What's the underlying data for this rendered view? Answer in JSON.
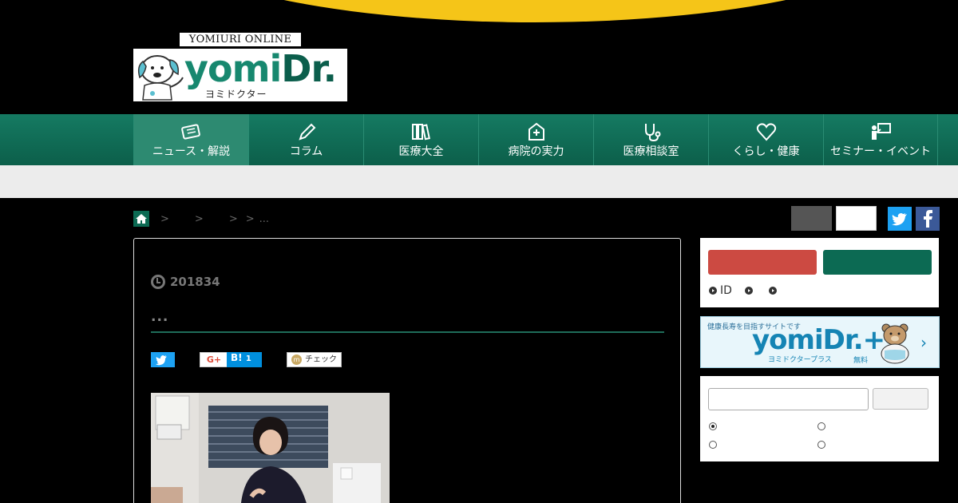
{
  "header": {
    "logo_online": "YOMIURI ONLINE",
    "logo_brand_yomi": "yomi",
    "logo_brand_dr": "Dr.",
    "logo_kana": "ヨミドクター"
  },
  "nav": {
    "items": [
      {
        "label": "ニュース・解説",
        "icon": "newspaper-icon",
        "active": true
      },
      {
        "label": "コラム",
        "icon": "pencil-icon"
      },
      {
        "label": "医療大全",
        "icon": "books-icon"
      },
      {
        "label": "病院の実力",
        "icon": "hospital-icon"
      },
      {
        "label": "医療相談室",
        "icon": "stethoscope-icon"
      },
      {
        "label": "くらし・健康",
        "icon": "heart-icon"
      },
      {
        "label": "セミナー・イベント",
        "icon": "presentation-icon"
      }
    ]
  },
  "breadcrumb": {
    "separators": [
      ">",
      ">",
      ">",
      ">"
    ],
    "tail": "..."
  },
  "article": {
    "date": "201834",
    "title_ellipsis": "...",
    "share": {
      "gplus": "G+",
      "hatena": "B!",
      "hatena_count": "1",
      "mixi": "チェック"
    }
  },
  "sidebar": {
    "login_links": [
      {
        "label": "ID"
      },
      {
        "label": ""
      },
      {
        "label": ""
      }
    ],
    "plus_banner": {
      "tagline": "健康長寿を目指すサイトです",
      "brand": "yomiDr.+",
      "kana": "ヨミドクタープラス",
      "free": "無料",
      "arrow": "›"
    }
  },
  "colors": {
    "nav_green": "#0c6a53",
    "accent_yellow": "#f5c518",
    "red_button": "#cc4a42",
    "twitter": "#1da1f2",
    "facebook": "#3b5998",
    "hatena": "#008fde"
  }
}
